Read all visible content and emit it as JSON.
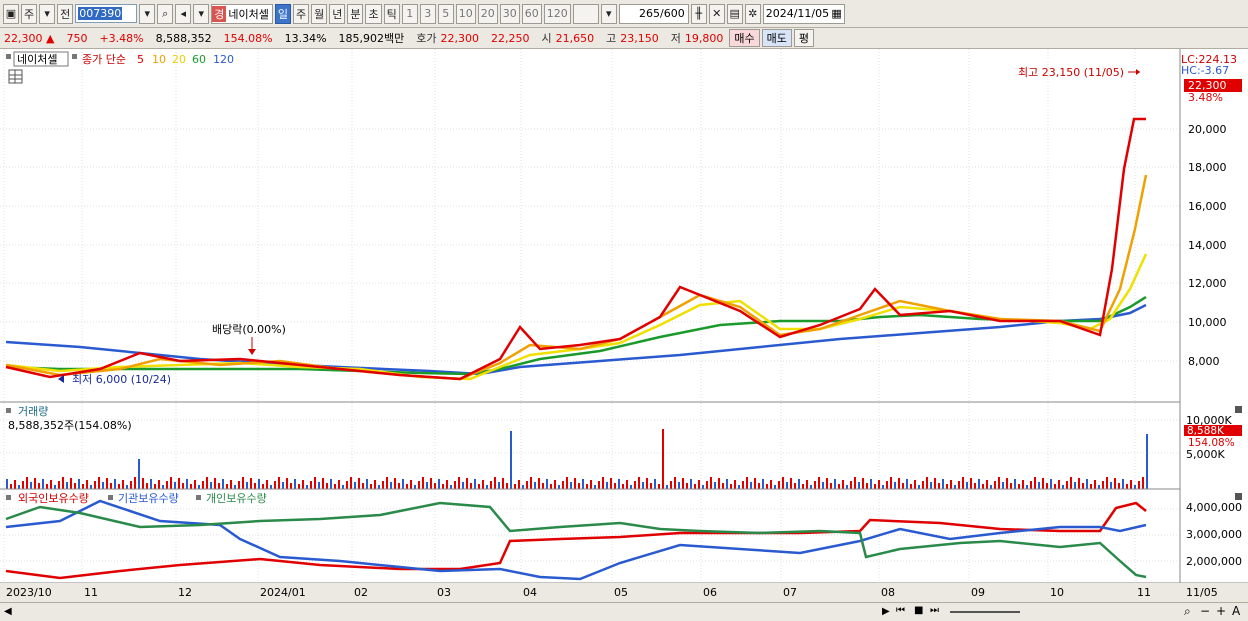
{
  "toolbar": {
    "type": "주",
    "prev": "전",
    "code": "007390",
    "name_badge": "경",
    "name": "네이처셀",
    "periods": [
      "일",
      "주",
      "월",
      "년",
      "분",
      "초",
      "틱"
    ],
    "active_period": "일",
    "intervals": [
      "1",
      "3",
      "5",
      "10",
      "20",
      "30",
      "60",
      "120"
    ],
    "count": "265",
    "count_total": "/600",
    "date": "2024/11/05"
  },
  "quote": {
    "price": "22,300",
    "arrow": "▲",
    "change": "750",
    "rate": "+3.48%",
    "volume": "8,588,352",
    "vol_rate": "154.08%",
    "turnover": "13.34%",
    "amount": "185,902백만",
    "hoga_label": "호가",
    "ask": "22,300",
    "bid": "22,250",
    "open_label": "시",
    "open": "21,650",
    "high_label": "고",
    "high": "23,150",
    "low_label": "저",
    "low": "19,800",
    "buy": "매수",
    "sell": "매도",
    "eval": "평"
  },
  "price_panel": {
    "name": "네이처셀",
    "ma_label": "종가 단순",
    "ma_periods": [
      "5",
      "10",
      "20",
      "60",
      "120"
    ],
    "ma_colors": [
      "#e00000",
      "#f0a000",
      "#f0e000",
      "#1a9a2a",
      "#2a5ad0"
    ],
    "lc": "LC:224.13",
    "hc": "HC:-3.67",
    "last_price": "22,300",
    "last_rate": "3.48%",
    "high_note": "최고 23,150 (11/05)",
    "low_note": "최저 6,000 (10/24)",
    "dividend_note": "배당락(0.00%)",
    "y_ticks": [
      "20,000",
      "18,000",
      "16,000",
      "14,000",
      "12,000",
      "10,000",
      "8,000"
    ]
  },
  "volume_panel": {
    "title": "거래량",
    "value": "8,588,352주(154.08%)",
    "y_ticks": [
      "10,000K",
      "5,000K"
    ],
    "last": "8,588K",
    "last_rate": "154.08%"
  },
  "holding_panel": {
    "series": [
      "외국인보유수량",
      "기관보유수량",
      "개인보유수량"
    ],
    "colors": [
      "#e00000",
      "#2a5ad0",
      "#2a8a4a"
    ],
    "y_ticks": [
      "4,000,000",
      "3,000,000",
      "2,000,000"
    ]
  },
  "x_axis": {
    "labels": [
      "2023/10",
      "11",
      "12",
      "2024/01",
      "02",
      "03",
      "04",
      "05",
      "06",
      "07",
      "08",
      "09",
      "10",
      "11"
    ],
    "right_label": "11/05"
  }
}
